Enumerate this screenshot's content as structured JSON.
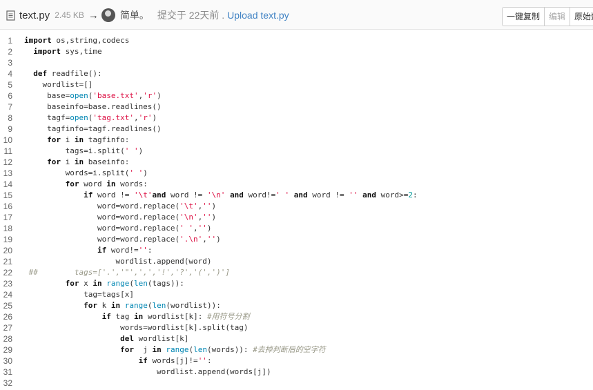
{
  "header": {
    "file_name": "text.py",
    "file_size": "2.45 KB",
    "arrow": "→",
    "author": "简单。",
    "commit_text": "提交于 22天前 .",
    "commit_message": "Upload text.py"
  },
  "toolbar": {
    "copy_label": "一键复制",
    "edit_label": "编辑",
    "raw_label": "原始数"
  },
  "code_lines": [
    "import os,string,codecs",
    "  import sys,time",
    "",
    "  def readfile():",
    "    wordlist=[]",
    "     base=open('base.txt','r')",
    "     baseinfo=base.readlines()",
    "     tagf=open('tag.txt','r')",
    "     tagfinfo=tagf.readlines()",
    "     for i in tagfinfo:",
    "         tags=i.split(' ')",
    "     for i in baseinfo:",
    "         words=i.split(' ')",
    "         for word in words:",
    "             if word != '\\t'and word != '\\n' and word!=' ' and word != '' and word>=2:",
    "                word=word.replace('\\t','')",
    "                word=word.replace('\\n','')",
    "                word=word.replace(' ','')",
    "                word=word.replace('.\\n','')",
    "                if word!='':",
    "                    wordlist.append(word)",
    " ##        tags=['.','\"',',','!','?','(',')']",
    "         for x in range(len(tags)):",
    "             tag=tags[x]",
    "             for k in range(len(wordlist)):",
    "                 if tag in wordlist[k]: #用符号分割",
    "                     words=wordlist[k].split(tag)",
    "                     del wordlist[k]",
    "                     for  j in range(len(words)): #去掉判断后的空字符",
    "                         if words[j]!='':",
    "                             wordlist.append(words[j])",
    ""
  ]
}
